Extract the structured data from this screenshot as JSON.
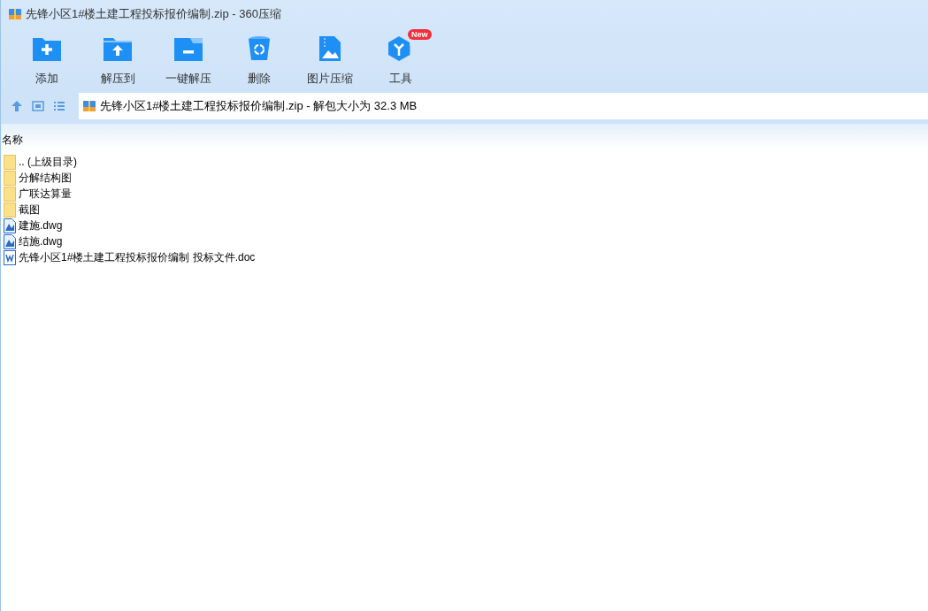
{
  "window": {
    "title": "先锋小区1#楼土建工程投标报价编制.zip - 360压缩"
  },
  "toolbar": [
    {
      "kind": "add",
      "label": "添加"
    },
    {
      "kind": "extract",
      "label": "解压到"
    },
    {
      "kind": "oneclick",
      "label": "一键解压"
    },
    {
      "kind": "delete",
      "label": "删除"
    },
    {
      "kind": "image",
      "label": "图片压缩"
    },
    {
      "kind": "tools",
      "label": "工具",
      "badge": "New"
    }
  ],
  "path_bar": {
    "text": "先锋小区1#楼土建工程投标报价编制.zip - 解包大小为 32.3 MB"
  },
  "file_list": {
    "columns": [
      "名称"
    ],
    "rows": [
      {
        "kind": "folder",
        "name": ".. (上级目录)"
      },
      {
        "kind": "folder",
        "name": "分解结构图"
      },
      {
        "kind": "folder",
        "name": "广联达算量"
      },
      {
        "kind": "folder",
        "name": "截图"
      },
      {
        "kind": "dwg",
        "name": "建施.dwg"
      },
      {
        "kind": "dwg",
        "name": "结施.dwg"
      },
      {
        "kind": "doc",
        "name": "先锋小区1#楼土建工程投标报价编制 投标文件.doc"
      }
    ]
  }
}
